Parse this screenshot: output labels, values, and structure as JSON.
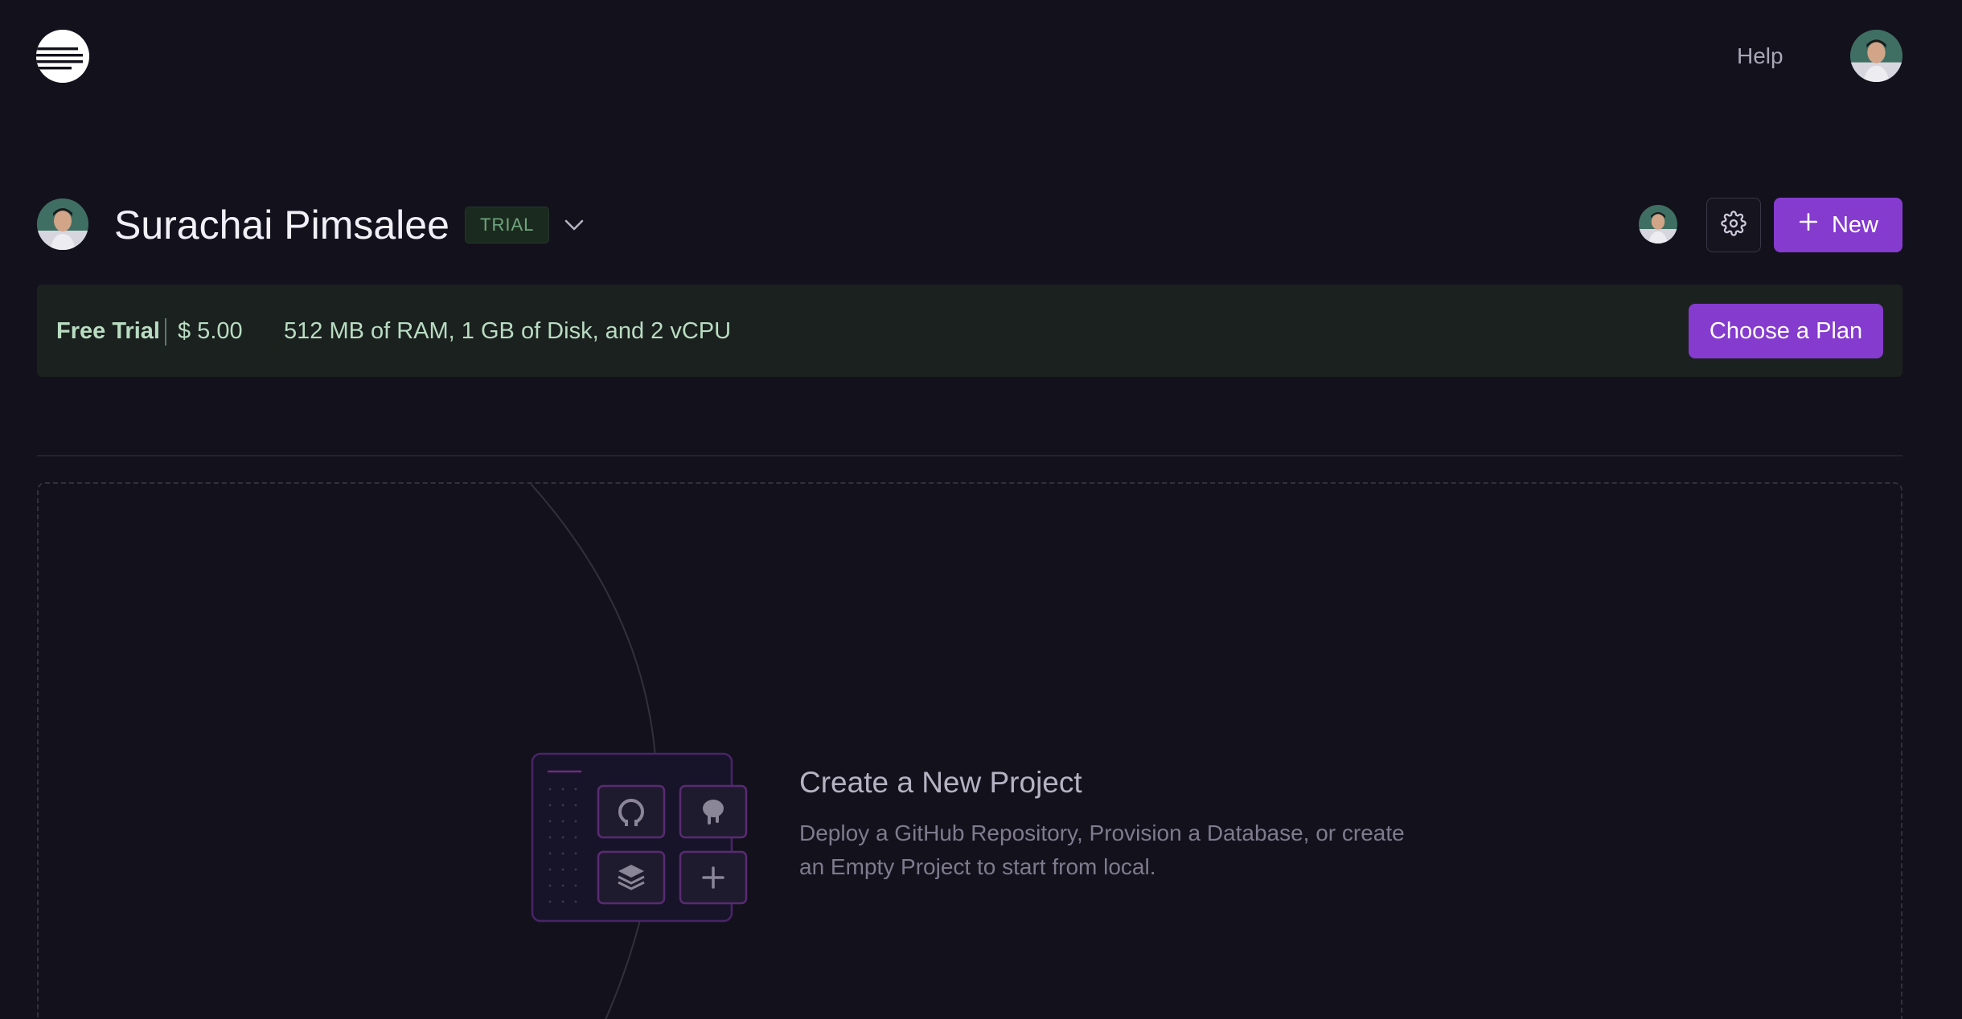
{
  "header": {
    "logo_icon": "railway-logo-icon",
    "help_label": "Help",
    "user_avatar_icon": "user-avatar"
  },
  "team": {
    "name": "Surachai Pimsalee",
    "badge": "TRIAL",
    "dropdown_icon": "chevron-down-icon",
    "settings_icon": "gear-icon",
    "new_button_label": "New",
    "new_button_icon": "plus-icon"
  },
  "banner": {
    "title": "Free Trial",
    "price": "$ 5.00",
    "specs": "512 MB of RAM, 1 GB of Disk, and 2 vCPU",
    "cta_label": "Choose a Plan"
  },
  "empty_state": {
    "title": "Create a New Project",
    "description": "Deploy a GitHub Repository, Provision a Database, or create an Empty Project to start from local.",
    "tiles": [
      "github-icon",
      "postgres-icon",
      "stack-icon",
      "plus-icon"
    ]
  },
  "colors": {
    "background": "#13111c",
    "accent": "#853bce",
    "banner_bg": "#1b211f",
    "banner_text": "#b9dcc2",
    "trial_badge_text": "#6fa67d"
  }
}
